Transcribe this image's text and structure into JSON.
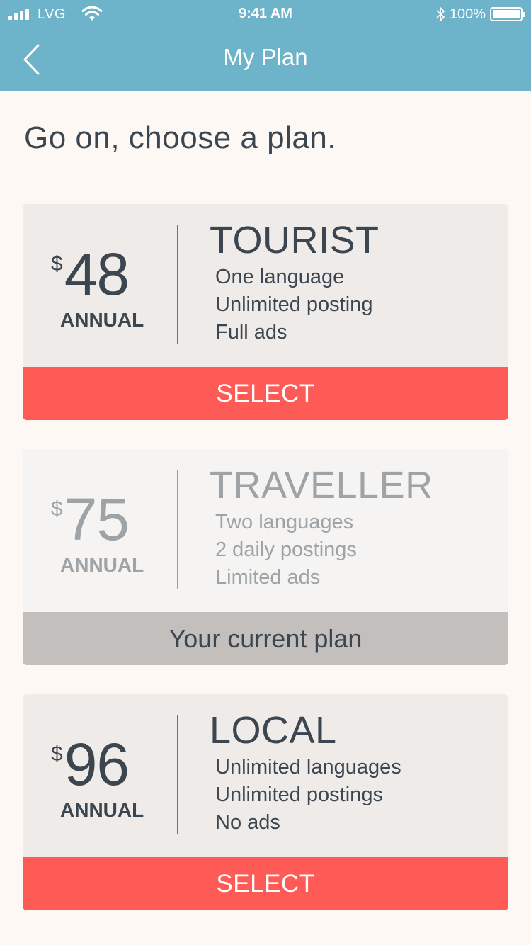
{
  "status_bar": {
    "carrier": "LVG",
    "time": "9:41 AM",
    "battery_percent": "100%"
  },
  "nav": {
    "title": "My Plan",
    "back_icon": "chevron-left-icon"
  },
  "headline": "Go on, choose a plan.",
  "plans": [
    {
      "currency": "$",
      "amount": "48",
      "period": "ANNUAL",
      "name": "TOURIST",
      "features": [
        "One language",
        "Unlimited posting",
        "Full ads"
      ],
      "action_label": "SELECT",
      "state": "selectable"
    },
    {
      "currency": "$",
      "amount": "75",
      "period": "ANNUAL",
      "name": "TRAVELLER",
      "features": [
        "Two languages",
        "2 daily postings",
        "Limited ads"
      ],
      "action_label": "Your current plan",
      "state": "current"
    },
    {
      "currency": "$",
      "amount": "96",
      "period": "ANNUAL",
      "name": "LOCAL",
      "features": [
        "Unlimited languages",
        "Unlimited postings",
        "No ads"
      ],
      "action_label": "SELECT",
      "state": "selectable"
    }
  ],
  "colors": {
    "nav_bar": "#6db3c9",
    "page_background": "#fdf8f4",
    "card_background": "#efebe8",
    "select_button": "#fe5a56",
    "current_plan_bar": "#c3bfbc",
    "text_dark": "#3b4650",
    "text_muted": "#9da3a7"
  }
}
